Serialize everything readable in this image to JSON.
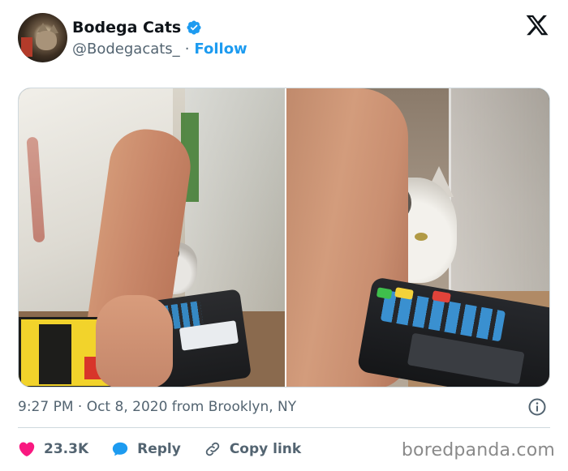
{
  "author": {
    "name": "Bodega Cats",
    "handle": "@Bodegacats_",
    "separator": "·",
    "follow_label": "Follow",
    "verified": true
  },
  "brand": {
    "icon": "x-logo-icon"
  },
  "media": {
    "photos": [
      {
        "description_icon": "photo-left"
      },
      {
        "description_icon": "photo-right"
      }
    ]
  },
  "meta": {
    "timestamp": "9:27 PM · Oct 8, 2020 from Brooklyn, NY",
    "info_icon": "info-icon"
  },
  "actions": {
    "likes_count": "23.3K",
    "reply_label": "Reply",
    "copy_link_label": "Copy link"
  },
  "watermark": "boredpanda.com",
  "colors": {
    "accent": "#1d9bf0",
    "like": "#f91880",
    "text": "#0f1419",
    "muted": "#536471"
  }
}
